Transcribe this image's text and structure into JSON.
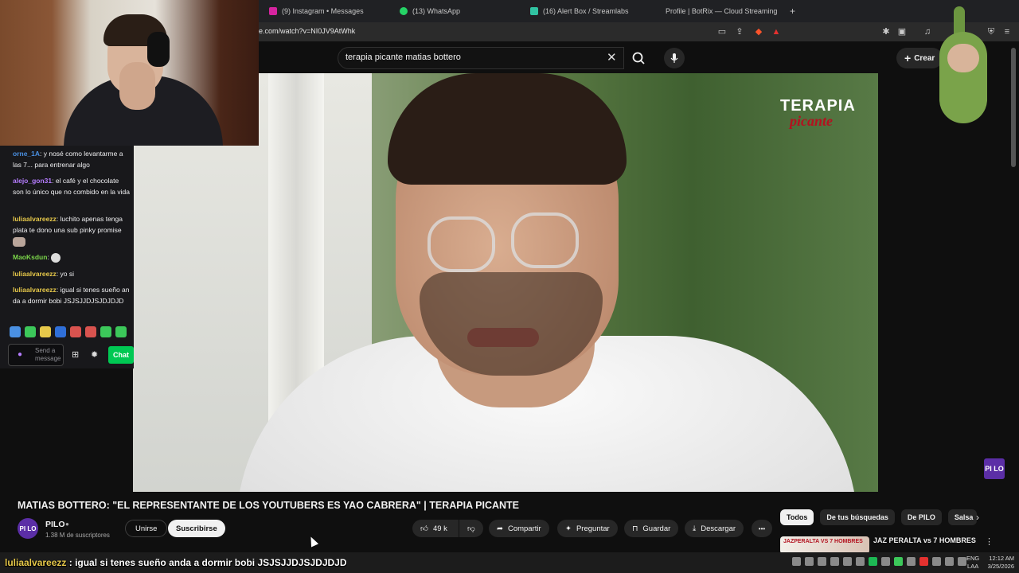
{
  "browser": {
    "tabs": [
      {
        "label": "(9) Instagram • Messages",
        "color": "#d6249f"
      },
      {
        "label": "(13) WhatsApp",
        "color": "#25d366"
      },
      {
        "label": "(16) Alert Box / Streamlabs",
        "color": "#31c3a2"
      },
      {
        "label": "Profile | BotRix — Cloud Streaming B",
        "color": "#ffffff"
      }
    ],
    "new_tab": "+",
    "url": "e.com/watch?v=NI0JV9AtWhk"
  },
  "youtube": {
    "search_query": "terapia picante matias bottero",
    "create_label": "Crear",
    "video_watermark_top": "TERAPIA",
    "video_watermark_bottom": "picante",
    "corner_badge": "PI LO",
    "video_title": "MATIAS BOTTERO: \"EL REPRESENTANTE DE LOS YOUTUBERS ES YAO CABRERA\" | TERAPIA PICANTE",
    "channel": {
      "avatar": "PI LO",
      "name": "PILO",
      "subscribers": "1.38 M de suscriptores",
      "join_label": "Unirse",
      "subscribe_label": "Suscribirse"
    },
    "actions": {
      "likes": "49 k",
      "share": "Compartir",
      "ask": "Preguntar",
      "save": "Guardar",
      "download": "Descargar",
      "more": "•••"
    },
    "filters": [
      "Todos",
      "De tus búsquedas",
      "De PILO",
      "Salsa"
    ],
    "recommendation": {
      "thumb_text": "JAZPERALTA VS 7 HOMBRES",
      "title": "JAZ PERALTA vs 7 HOMBRES"
    }
  },
  "chat": {
    "messages": [
      {
        "user": "orne_1A",
        "text": ": y nosé como levantarme a las 7... para entrenar algo",
        "color": "#4a90e2"
      },
      {
        "user": "alejo_gon31",
        "text": ": el café y el chocolate son lo único que no combido en la vida",
        "color": "#b57cff"
      },
      {
        "user": "luliaalvareezz",
        "text": ": luchito apenas tenga plata te dono una sub pinky promise",
        "color": "#e6c84a"
      },
      {
        "user": "MaoKsdun",
        "text": ":",
        "color": "#7bd64a"
      },
      {
        "user": "luliaalvareezz",
        "text": ": yo si",
        "color": "#e6c84a"
      },
      {
        "user": "luliaalvareezz",
        "text": ": igual si tenes sueño anda a dormir bobi JSJSJJDJSJDJDJD",
        "color": "#e6c84a"
      }
    ],
    "input_placeholder": "Send a message",
    "send_label": "Chat",
    "emote_colors": [
      "#4a90e2",
      "#3cc85a",
      "#e6c84a",
      "#2f6fd8",
      "#d9534f",
      "#d9534f",
      "#3cc85a",
      "#3cc85a"
    ]
  },
  "overlay": {
    "user": "luliaalvareezz",
    "text": ": igual si tenes sueño anda a dormir bobi JSJSJJDJSJDJDJD"
  },
  "taskbar": {
    "lang_top": "ENG",
    "lang_bottom": "LAA",
    "time": "12:12 AM",
    "date": "3/25/2026"
  }
}
